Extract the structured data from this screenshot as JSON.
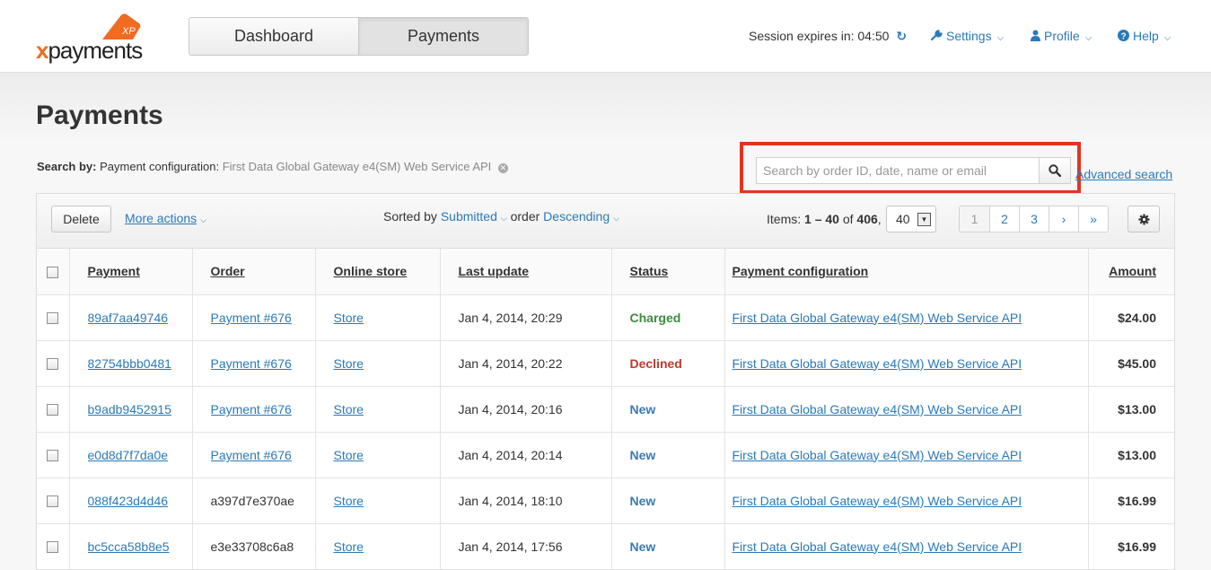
{
  "brand": {
    "logo_word": "payments",
    "logo_x": "x",
    "logo_tag": "XP"
  },
  "nav": {
    "tabs": [
      {
        "label": "Dashboard"
      },
      {
        "label": "Payments"
      }
    ]
  },
  "header": {
    "session_text": "Session expires in: 04:50",
    "settings_label": "Settings",
    "profile_label": "Profile",
    "help_label": "Help"
  },
  "page": {
    "title": "Payments"
  },
  "search": {
    "by_label": "Search by:",
    "filter_name": "Payment configuration:",
    "filter_value": "First Data Global Gateway e4(SM) Web Service API",
    "placeholder": "Search by order ID, date, name or email",
    "advanced_label": "Advanced search"
  },
  "toolbar": {
    "delete_label": "Delete",
    "more_actions_label": "More actions",
    "sorted_by_label": "Sorted by",
    "sort_field": "Submitted",
    "order_label": "order",
    "order_value": "Descending",
    "items_label": "Items:",
    "items_range": "1 – 40",
    "items_of": "of",
    "items_total": "406",
    "per_page": "40",
    "pages": [
      "1",
      "2",
      "3",
      "›",
      "»"
    ]
  },
  "table": {
    "columns": [
      "Payment",
      "Order",
      "Online store",
      "Last update",
      "Status",
      "Payment configuration",
      "Amount"
    ],
    "rows": [
      {
        "payment": "89af7aa49746",
        "order": "Payment #676",
        "order_link": true,
        "store": "Store",
        "updated": "Jan 4, 2014, 20:29",
        "status": "Charged",
        "config": "First Data Global Gateway e4(SM) Web Service API",
        "amount": "$24.00"
      },
      {
        "payment": "82754bbb0481",
        "order": "Payment #676",
        "order_link": true,
        "store": "Store",
        "updated": "Jan 4, 2014, 20:22",
        "status": "Declined",
        "config": "First Data Global Gateway e4(SM) Web Service API",
        "amount": "$45.00"
      },
      {
        "payment": "b9adb9452915",
        "order": "Payment #676",
        "order_link": true,
        "store": "Store",
        "updated": "Jan 4, 2014, 20:16",
        "status": "New",
        "config": "First Data Global Gateway e4(SM) Web Service API",
        "amount": "$13.00"
      },
      {
        "payment": "e0d8d7f7da0e",
        "order": "Payment #676",
        "order_link": true,
        "store": "Store",
        "updated": "Jan 4, 2014, 20:14",
        "status": "New",
        "config": "First Data Global Gateway e4(SM) Web Service API",
        "amount": "$13.00"
      },
      {
        "payment": "088f423d4d46",
        "order": "a397d7e370ae",
        "order_link": false,
        "store": "Store",
        "updated": "Jan 4, 2014, 18:10",
        "status": "New",
        "config": "First Data Global Gateway e4(SM) Web Service API",
        "amount": "$16.99"
      },
      {
        "payment": "bc5cca58b8e5",
        "order": "e3e33708c6a8",
        "order_link": false,
        "store": "Store",
        "updated": "Jan 4, 2014, 17:56",
        "status": "New",
        "config": "First Data Global Gateway e4(SM) Web Service API",
        "amount": "$16.99"
      }
    ]
  },
  "colors": {
    "accent": "#2a7ab8",
    "brand_orange": "#f26b21",
    "status_charged": "#3d8b3d",
    "status_declined": "#c0392b",
    "status_new": "#3a7ab0",
    "highlight": "#e8321e"
  },
  "icons": {
    "refresh": "refresh-icon",
    "settings": "wrench-icon",
    "profile": "user-icon",
    "help": "question-circle-icon",
    "search": "search-icon",
    "gear": "gear-icon"
  }
}
